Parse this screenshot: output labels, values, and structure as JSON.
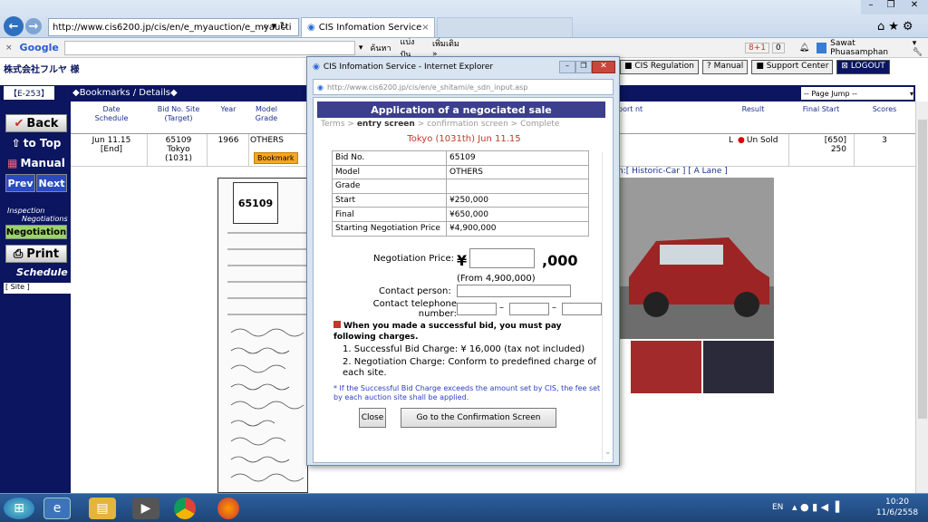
{
  "browser": {
    "address": "http://www.cis6200.jp/cis/en/e_myauction/e_myaucti",
    "address_domain": "cis6200.jp",
    "tab1": "CIS Infomation Service",
    "google_label": "Google",
    "toolbar_items": [
      "ค้นหา",
      "แบ่งปัน",
      "เพิ่มเติม »"
    ],
    "badge": "8+1",
    "badge2": "0",
    "user": "Sawat Phuasamphan"
  },
  "page": {
    "company": "株式会社フルヤ 様",
    "top_links": [
      "CIS Regulation",
      "Manual",
      "Support Center",
      "LOGOUT"
    ],
    "tag": "【E-253】",
    "breadcrumb": "◆Bookmarks / Details◆",
    "page_jump": "-- Page Jump --",
    "sidebar": {
      "back": "Back",
      "to_top": "to Top",
      "manual": "Manual",
      "prev": "Prev",
      "next": "Next",
      "inspection": "Inspection",
      "negotiations": "Negotiations",
      "negotiation": "Negotiation",
      "print": "Print",
      "schedule": "Schedule",
      "site": "[ Site ]"
    },
    "headers": {
      "date": "Date Schedule",
      "bidno": "Bid No. Site (Target)",
      "year": "Year",
      "model": "Model Grade",
      "report": "port\nnt",
      "result": "Result",
      "final": "Final Start",
      "scores": "Scores"
    },
    "row": {
      "date": "Jun 11.15",
      "date2": "[End]",
      "bidno": "65109",
      "site": "Tokyo",
      "target": "(1031)",
      "year": "1966",
      "model": "OTHERS",
      "bookmark": "Bookmark",
      "grade_mark": "L",
      "result": "Un Sold",
      "final": "[650]",
      "start": "250",
      "score": "3"
    },
    "lane": "n:[ Historic-Car ] [ A Lane ]",
    "sheet_no": "65109"
  },
  "popup": {
    "window_title": "CIS Infomation Service - Internet Explorer",
    "address": "http://www.cis6200.jp/cis/en/e_shitami/e_sdn_input.asp",
    "heading": "Application of a negociated sale",
    "steps": [
      "Terms",
      "entry screen",
      "confirmation screen",
      "Complete"
    ],
    "sep": ">",
    "auction": "Tokyo  (1031th)  Jun 11.15",
    "info": [
      [
        "Bid No.",
        "65109"
      ],
      [
        "Model",
        "OTHERS"
      ],
      [
        "Grade",
        ""
      ],
      [
        "Start",
        "¥250,000"
      ],
      [
        "Final",
        "¥650,000"
      ],
      [
        "Starting Negotiation Price",
        "¥4,900,000"
      ]
    ],
    "neg_price_label": "Negotiation Price:",
    "yen": "¥",
    "thousand": ",000",
    "from": "(From 4,900,000)",
    "contact_person": "Contact person:",
    "contact_tel": "Contact telephone number:",
    "dash": "–",
    "notice": "When you made a successful bid, you must pay following charges.",
    "charge1": "1. Successful Bid Charge: ¥ 16,000 (tax not included)",
    "charge2": "2. Negotiation Charge: Conform to predefined charge of each site.",
    "footnote": "* If the Successful Bid Charge exceeds the amount set by CIS, the fee set by each auction site shall be applied.",
    "close_btn": "Close",
    "confirm_btn": "Go to the Confirmation Screen"
  },
  "taskbar": {
    "lang": "EN",
    "time": "10:20",
    "date": "11/6/2558"
  },
  "colors": {
    "navy": "#0b1560",
    "popup_header": "#3b3f8c",
    "auction_red": "#c0392b",
    "bookmark": "#f5a623"
  }
}
